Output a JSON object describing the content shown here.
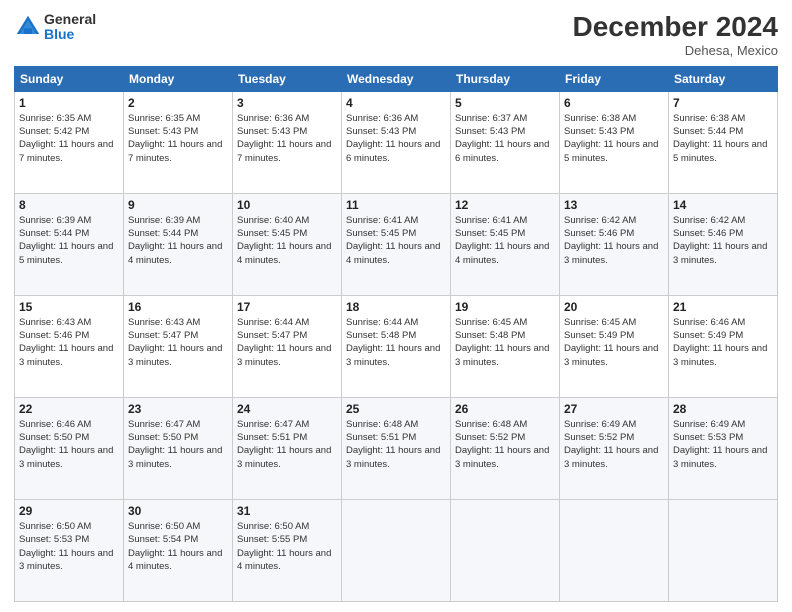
{
  "header": {
    "logo_general": "General",
    "logo_blue": "Blue",
    "month_title": "December 2024",
    "location": "Dehesa, Mexico"
  },
  "days_of_week": [
    "Sunday",
    "Monday",
    "Tuesday",
    "Wednesday",
    "Thursday",
    "Friday",
    "Saturday"
  ],
  "weeks": [
    [
      {
        "day": "1",
        "sunrise": "6:35 AM",
        "sunset": "5:42 PM",
        "daylight": "11 hours and 7 minutes."
      },
      {
        "day": "2",
        "sunrise": "6:35 AM",
        "sunset": "5:43 PM",
        "daylight": "11 hours and 7 minutes."
      },
      {
        "day": "3",
        "sunrise": "6:36 AM",
        "sunset": "5:43 PM",
        "daylight": "11 hours and 7 minutes."
      },
      {
        "day": "4",
        "sunrise": "6:36 AM",
        "sunset": "5:43 PM",
        "daylight": "11 hours and 6 minutes."
      },
      {
        "day": "5",
        "sunrise": "6:37 AM",
        "sunset": "5:43 PM",
        "daylight": "11 hours and 6 minutes."
      },
      {
        "day": "6",
        "sunrise": "6:38 AM",
        "sunset": "5:43 PM",
        "daylight": "11 hours and 5 minutes."
      },
      {
        "day": "7",
        "sunrise": "6:38 AM",
        "sunset": "5:44 PM",
        "daylight": "11 hours and 5 minutes."
      }
    ],
    [
      {
        "day": "8",
        "sunrise": "6:39 AM",
        "sunset": "5:44 PM",
        "daylight": "11 hours and 5 minutes."
      },
      {
        "day": "9",
        "sunrise": "6:39 AM",
        "sunset": "5:44 PM",
        "daylight": "11 hours and 4 minutes."
      },
      {
        "day": "10",
        "sunrise": "6:40 AM",
        "sunset": "5:45 PM",
        "daylight": "11 hours and 4 minutes."
      },
      {
        "day": "11",
        "sunrise": "6:41 AM",
        "sunset": "5:45 PM",
        "daylight": "11 hours and 4 minutes."
      },
      {
        "day": "12",
        "sunrise": "6:41 AM",
        "sunset": "5:45 PM",
        "daylight": "11 hours and 4 minutes."
      },
      {
        "day": "13",
        "sunrise": "6:42 AM",
        "sunset": "5:46 PM",
        "daylight": "11 hours and 3 minutes."
      },
      {
        "day": "14",
        "sunrise": "6:42 AM",
        "sunset": "5:46 PM",
        "daylight": "11 hours and 3 minutes."
      }
    ],
    [
      {
        "day": "15",
        "sunrise": "6:43 AM",
        "sunset": "5:46 PM",
        "daylight": "11 hours and 3 minutes."
      },
      {
        "day": "16",
        "sunrise": "6:43 AM",
        "sunset": "5:47 PM",
        "daylight": "11 hours and 3 minutes."
      },
      {
        "day": "17",
        "sunrise": "6:44 AM",
        "sunset": "5:47 PM",
        "daylight": "11 hours and 3 minutes."
      },
      {
        "day": "18",
        "sunrise": "6:44 AM",
        "sunset": "5:48 PM",
        "daylight": "11 hours and 3 minutes."
      },
      {
        "day": "19",
        "sunrise": "6:45 AM",
        "sunset": "5:48 PM",
        "daylight": "11 hours and 3 minutes."
      },
      {
        "day": "20",
        "sunrise": "6:45 AM",
        "sunset": "5:49 PM",
        "daylight": "11 hours and 3 minutes."
      },
      {
        "day": "21",
        "sunrise": "6:46 AM",
        "sunset": "5:49 PM",
        "daylight": "11 hours and 3 minutes."
      }
    ],
    [
      {
        "day": "22",
        "sunrise": "6:46 AM",
        "sunset": "5:50 PM",
        "daylight": "11 hours and 3 minutes."
      },
      {
        "day": "23",
        "sunrise": "6:47 AM",
        "sunset": "5:50 PM",
        "daylight": "11 hours and 3 minutes."
      },
      {
        "day": "24",
        "sunrise": "6:47 AM",
        "sunset": "5:51 PM",
        "daylight": "11 hours and 3 minutes."
      },
      {
        "day": "25",
        "sunrise": "6:48 AM",
        "sunset": "5:51 PM",
        "daylight": "11 hours and 3 minutes."
      },
      {
        "day": "26",
        "sunrise": "6:48 AM",
        "sunset": "5:52 PM",
        "daylight": "11 hours and 3 minutes."
      },
      {
        "day": "27",
        "sunrise": "6:49 AM",
        "sunset": "5:52 PM",
        "daylight": "11 hours and 3 minutes."
      },
      {
        "day": "28",
        "sunrise": "6:49 AM",
        "sunset": "5:53 PM",
        "daylight": "11 hours and 3 minutes."
      }
    ],
    [
      {
        "day": "29",
        "sunrise": "6:50 AM",
        "sunset": "5:53 PM",
        "daylight": "11 hours and 3 minutes."
      },
      {
        "day": "30",
        "sunrise": "6:50 AM",
        "sunset": "5:54 PM",
        "daylight": "11 hours and 4 minutes."
      },
      {
        "day": "31",
        "sunrise": "6:50 AM",
        "sunset": "5:55 PM",
        "daylight": "11 hours and 4 minutes."
      },
      null,
      null,
      null,
      null
    ]
  ]
}
